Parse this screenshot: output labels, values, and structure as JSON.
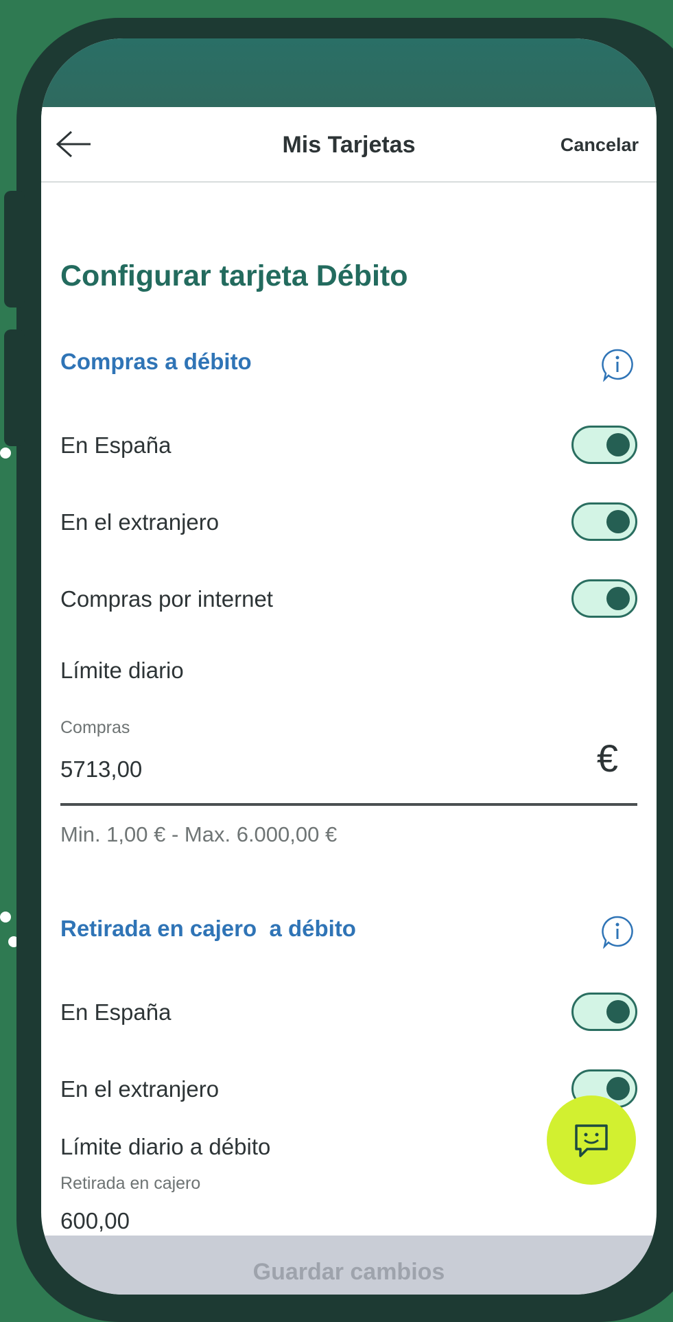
{
  "header": {
    "title": "Mis Tarjetas",
    "cancel_label": "Cancelar"
  },
  "page": {
    "title": "Configurar tarjeta Débito"
  },
  "purchases": {
    "section_title": "Compras a débito",
    "toggles": [
      {
        "label": "En España",
        "on": true
      },
      {
        "label": "En el extranjero",
        "on": true
      },
      {
        "label": "Compras por internet",
        "on": true
      }
    ],
    "limit_heading": "Límite diario",
    "field_label": "Compras",
    "field_value": "5713,00",
    "currency_symbol": "€",
    "hint": "Min. 1,00 € - Max. 6.000,00 €"
  },
  "atm": {
    "section_title": "Retirada en cajero  a débito",
    "toggles": [
      {
        "label": "En España",
        "on": true
      },
      {
        "label": "En el extranjero",
        "on": true
      }
    ],
    "limit_heading": "Límite diario a débito",
    "field_label": "Retirada en cajero",
    "field_value": "600,00"
  },
  "footer": {
    "save_label": "Guardar cambios"
  },
  "icons": {
    "back": "arrow-left-icon",
    "info": "info-bubble-icon",
    "chat": "chat-smile-icon"
  },
  "colors": {
    "accent_green": "#236b5e",
    "section_blue": "#2f74b6",
    "toggle_track": "#d3f4e5",
    "chat_button": "#d2f030",
    "background": "#2f7a52"
  }
}
